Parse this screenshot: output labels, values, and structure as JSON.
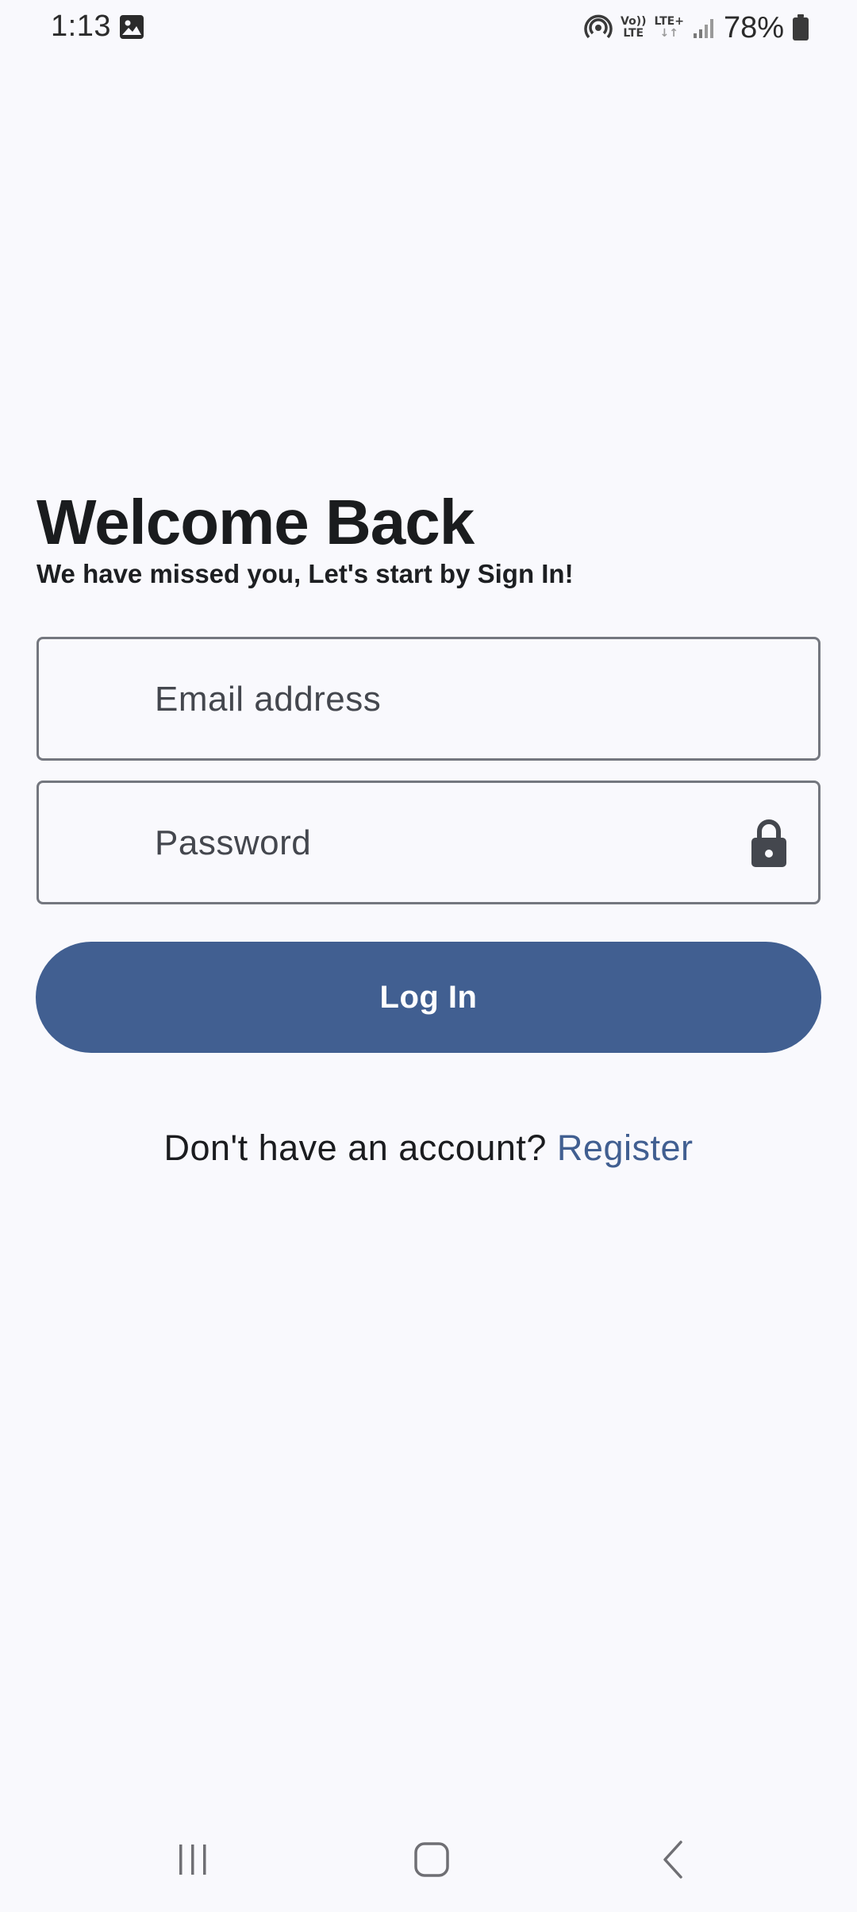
{
  "status_bar": {
    "time": "1:13",
    "volte_top": "Vo))",
    "volte_bottom": "LTE",
    "network": "LTE+",
    "battery": "78%"
  },
  "welcome": {
    "title": "Welcome Back",
    "subtitle": "We have missed you, Let's start by Sign In!"
  },
  "form": {
    "email_placeholder": "Email address",
    "email_value": "",
    "password_placeholder": "Password",
    "password_value": "",
    "login_label": "Log In"
  },
  "register": {
    "prompt": "Don't have an account?",
    "link_label": "Register"
  },
  "icons": {
    "gallery": "image-icon",
    "hotspot": "hotspot-icon",
    "signal": "signal-icon",
    "battery": "battery-icon",
    "lock": "lock-icon",
    "recents": "recents-icon",
    "home": "home-icon",
    "back": "back-icon"
  },
  "colors": {
    "background": "#f9f9fd",
    "primary": "#415f91",
    "outline": "#74777f",
    "text": "#1b1c1f"
  }
}
